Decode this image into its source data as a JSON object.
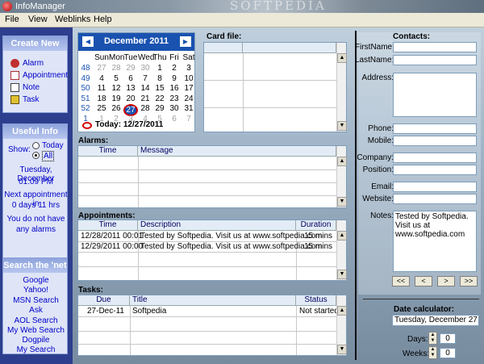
{
  "window": {
    "title": "InfoManager",
    "watermark": "SOFTPEDIA"
  },
  "menu": [
    "File",
    "View",
    "Weblinks",
    "Help"
  ],
  "sidebar": {
    "create_new": {
      "heading": "Create New",
      "items": [
        "Alarm",
        "Appointment",
        "Note",
        "Task"
      ]
    },
    "useful_info": {
      "heading": "Useful Info",
      "show_label": "Show:",
      "radio_today": "Today",
      "radio_all": "All",
      "date_line": "Tuesday, December",
      "time_line": "01:09 PM",
      "next_appt_1": "Next appointment in",
      "next_appt_2": "0 days 11 hrs",
      "alarms_1": "You do not have",
      "alarms_2": "any alarms"
    },
    "search": {
      "heading": "Search the 'net",
      "items": [
        "Google",
        "Yahoo!",
        "MSN Search",
        "Ask",
        "AOL Search",
        "My Web Search",
        "Dogpile",
        "My Search"
      ]
    }
  },
  "calendar": {
    "month_title": "December 2011",
    "weekdays": [
      "Sun",
      "Mon",
      "Tue",
      "Wed",
      "Thu",
      "Fri",
      "Sat"
    ],
    "weeks": [
      "48",
      "49",
      "50",
      "51",
      "52",
      "1"
    ],
    "rows": [
      [
        "27",
        "28",
        "29",
        "30",
        "1",
        "2",
        "3"
      ],
      [
        "4",
        "5",
        "6",
        "7",
        "8",
        "9",
        "10"
      ],
      [
        "11",
        "12",
        "13",
        "14",
        "15",
        "16",
        "17"
      ],
      [
        "18",
        "19",
        "20",
        "21",
        "22",
        "23",
        "24"
      ],
      [
        "25",
        "26",
        "27",
        "28",
        "29",
        "30",
        "31"
      ],
      [
        "1",
        "2",
        "3",
        "4",
        "5",
        "6",
        "7"
      ]
    ],
    "today_label": "Today: 12/27/2011"
  },
  "card_file": {
    "label": "Card file:"
  },
  "alarms": {
    "label": "Alarms:",
    "columns": [
      "Time",
      "Message"
    ]
  },
  "appointments": {
    "label": "Appointments:",
    "columns": [
      "Time",
      "Description",
      "Duration"
    ],
    "rows": [
      [
        "12/28/2011 00:01",
        "Tested by Softpedia. Visit us at www.softpedia.com",
        "15 mins"
      ],
      [
        "12/29/2011 00:00",
        "Tested by Softpedia. Visit us at www.softpedia.com",
        "15 mins"
      ]
    ]
  },
  "tasks": {
    "label": "Tasks:",
    "columns": [
      "Due",
      "Title",
      "Status"
    ],
    "rows": [
      [
        "27-Dec-11",
        "Softpedia",
        "Not started"
      ]
    ]
  },
  "contacts": {
    "heading": "Contacts:",
    "labels": {
      "firstname": "FirstName:",
      "lastname": "LastName:",
      "address": "Address:",
      "phone": "Phone:",
      "mobile": "Mobile:",
      "company": "Company:",
      "position": "Position:",
      "email": "Email:",
      "website": "Website:",
      "notes": "Notes:"
    },
    "notes_value": "Tested by Softpedia. Visit us at www.softpedia.com",
    "nav": [
      "<<",
      "<",
      ">",
      ">>"
    ]
  },
  "date_calculator": {
    "heading": "Date calculator:",
    "date_value": "Tuesday, December 27,",
    "days_label": "Days:",
    "days_value": "0",
    "weeks_label": "Weeks:",
    "weeks_value": "0"
  }
}
